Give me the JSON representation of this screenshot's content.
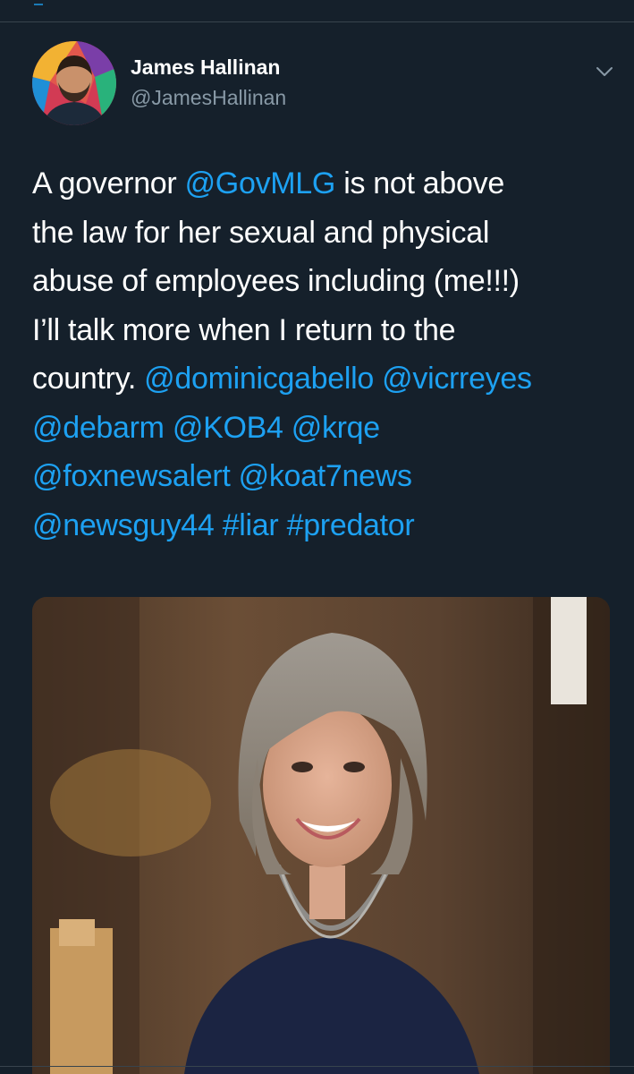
{
  "tweet": {
    "author": {
      "display_name": "James Hallinan",
      "handle": "@JamesHallinan"
    },
    "lines": [
      [
        {
          "t": "A governor ",
          "link": false
        },
        {
          "t": "@GovMLG",
          "link": true
        },
        {
          "t": " is not above",
          "link": false
        }
      ],
      [
        {
          "t": "the law for her sexual and physical",
          "link": false
        }
      ],
      [
        {
          "t": "abuse of employees including (me!!!)",
          "link": false
        }
      ],
      [
        {
          "t": "I’ll talk more when I return to the",
          "link": false
        }
      ],
      [
        {
          "t": "country. ",
          "link": false
        },
        {
          "t": "@dominicgabello",
          "link": true
        },
        {
          "t": " ",
          "link": false
        },
        {
          "t": "@vicrreyes",
          "link": true
        }
      ],
      [
        {
          "t": "@debarm",
          "link": true
        },
        {
          "t": " ",
          "link": false
        },
        {
          "t": "@KOB4",
          "link": true
        },
        {
          "t": " ",
          "link": false
        },
        {
          "t": "@krqe",
          "link": true
        }
      ],
      [
        {
          "t": "@foxnewsalert",
          "link": true
        },
        {
          "t": " ",
          "link": false
        },
        {
          "t": "@koat7news",
          "link": true
        }
      ],
      [
        {
          "t": "@newsguy44",
          "link": true
        },
        {
          "t": " ",
          "link": false
        },
        {
          "t": "#liar",
          "link": true
        },
        {
          "t": " ",
          "link": false
        },
        {
          "t": "#predator",
          "link": true
        }
      ]
    ]
  },
  "icons": {
    "more_menu": "chevron-down-icon",
    "back": "back-icon"
  },
  "colors": {
    "background": "#15202b",
    "link": "#1da1f2",
    "secondary_text": "#8899a6",
    "divider": "#38444d"
  }
}
